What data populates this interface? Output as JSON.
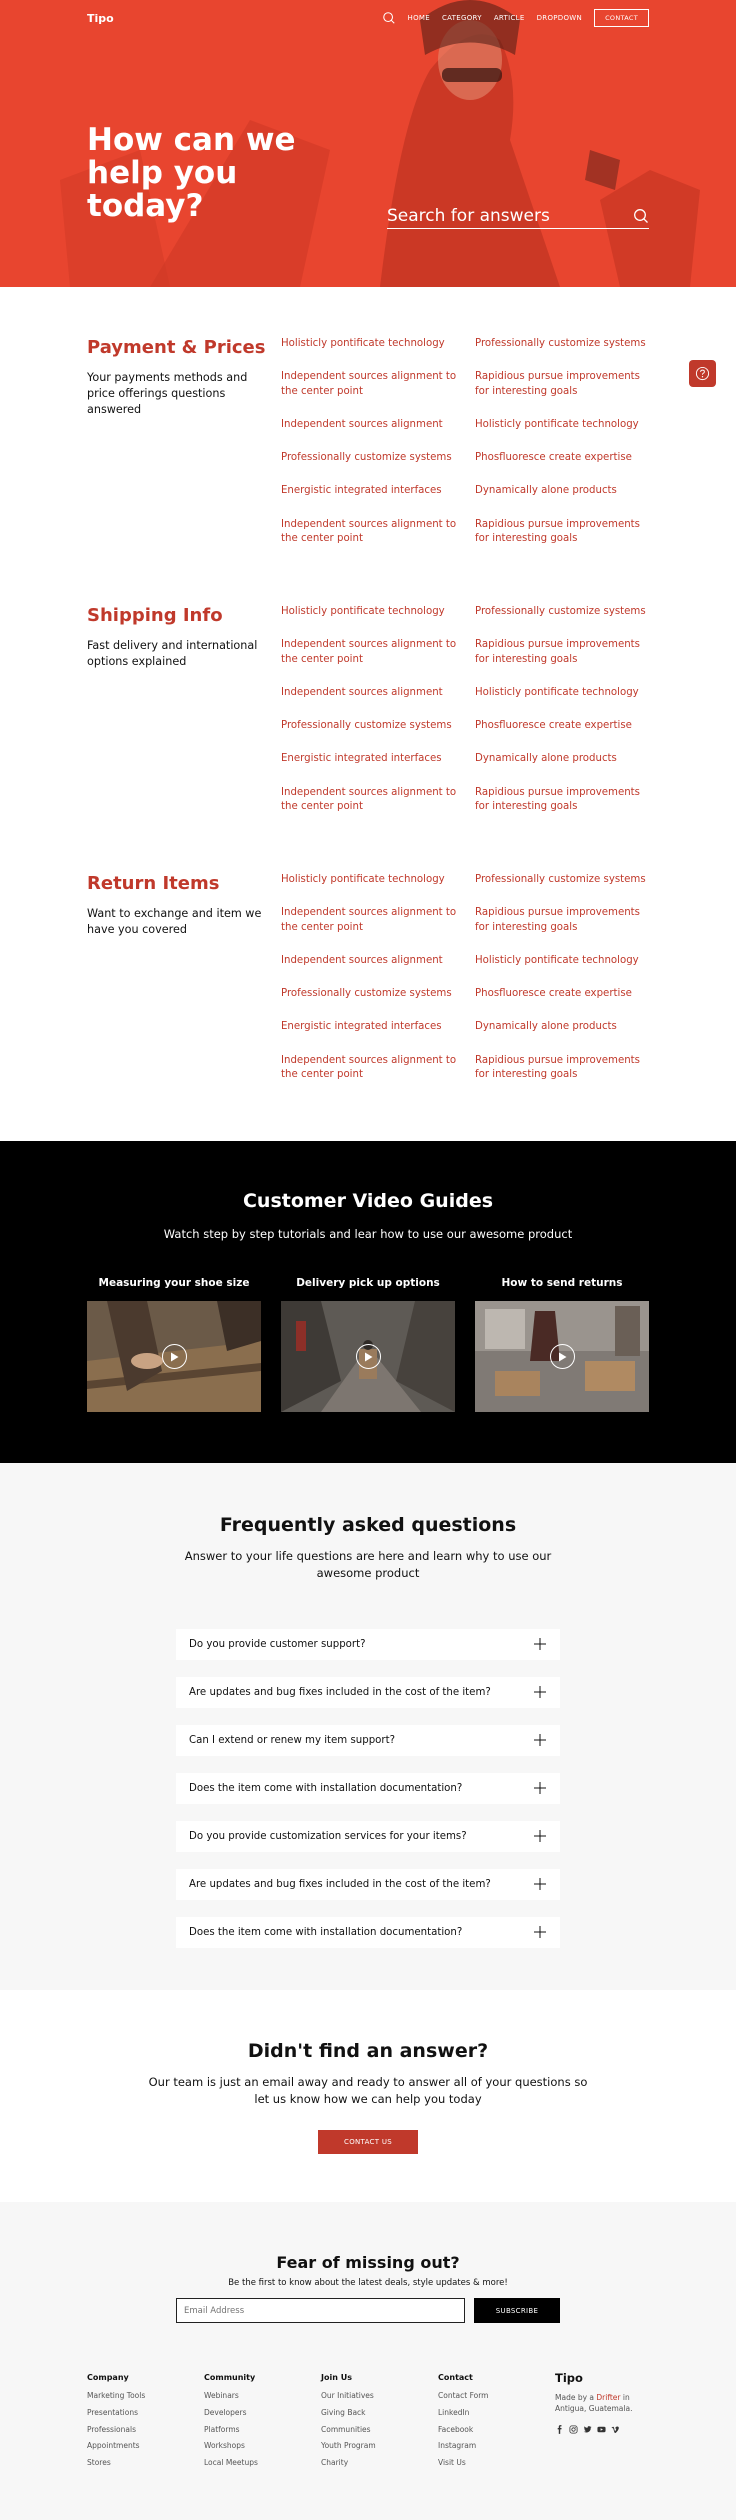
{
  "nav": {
    "logo": "Tipo",
    "links": [
      "HOME",
      "CATEGORY",
      "ARTICLE",
      "DROPDOWN"
    ],
    "contact_label": "CONTACT"
  },
  "hero": {
    "title": "How can we help you today?",
    "search_placeholder": "Search for answers"
  },
  "help_sections": [
    {
      "title": "Payment & Prices",
      "subtitle": "Your payments methods and price offerings questions answered",
      "links": [
        "Holisticly pontificate technology",
        "Professionally customize systems",
        "Independent sources alignment to the center point",
        "Rapidious pursue improvements for interesting goals",
        "Independent sources alignment",
        "Holisticly pontificate technology",
        "Professionally customize systems",
        "Phosfluoresce create expertise",
        "Energistic integrated interfaces",
        "Dynamically alone products",
        "Independent sources alignment to the center point",
        "Rapidious pursue improvements for interesting goals"
      ]
    },
    {
      "title": "Shipping Info",
      "subtitle": "Fast delivery and international options explained",
      "links": [
        "Holisticly pontificate technology",
        "Professionally customize systems",
        "Independent sources alignment to the center point",
        "Rapidious pursue improvements for interesting goals",
        "Independent sources alignment",
        "Holisticly pontificate technology",
        "Professionally customize systems",
        "Phosfluoresce create expertise",
        "Energistic integrated interfaces",
        "Dynamically alone products",
        "Independent sources alignment to the center point",
        "Rapidious pursue improvements for interesting goals"
      ]
    },
    {
      "title": "Return Items",
      "subtitle": "Want to exchange and item we have you covered",
      "links": [
        "Holisticly pontificate technology",
        "Professionally customize systems",
        "Independent sources alignment to the center point",
        "Rapidious pursue improvements for interesting goals",
        "Independent sources alignment",
        "Holisticly pontificate technology",
        "Professionally customize systems",
        "Phosfluoresce create expertise",
        "Energistic integrated interfaces",
        "Dynamically alone products",
        "Independent sources alignment to the center point",
        "Rapidious pursue improvements for interesting goals"
      ]
    }
  ],
  "videos": {
    "title": "Customer Video Guides",
    "subtitle": "Watch step by step tutorials and lear how to use our awesome product",
    "items": [
      {
        "label": "Measuring your shoe size"
      },
      {
        "label": "Delivery pick up options"
      },
      {
        "label": "How to send returns"
      }
    ]
  },
  "faq": {
    "title": "Frequently asked questions",
    "subtitle": "Answer to your life questions are here and learn why to use our awesome product",
    "questions": [
      "Do you provide customer support?",
      "Are updates and bug fixes included in the cost of the item?",
      "Can I extend or renew my item support?",
      "Does the item come with installation documentation?",
      "Do you provide customization services for your items?",
      "Are updates and bug fixes included in the cost of the item?",
      "Does the item come with installation documentation?"
    ]
  },
  "no_answer": {
    "title": "Didn't find an answer?",
    "subtitle": "Our team is just an email away and ready to answer all of your questions so let us know how we can help you today",
    "button": "CONTACT US"
  },
  "newsletter": {
    "title": "Fear of missing out?",
    "subtitle": "Be the first to know about the latest deals, style updates & more!",
    "placeholder": "Email Address",
    "button": "SUBSCRIBE"
  },
  "footer": {
    "columns": [
      {
        "title": "Company",
        "links": [
          "Marketing Tools",
          "Presentations",
          "Professionals",
          "Appointments",
          "Stores"
        ]
      },
      {
        "title": "Community",
        "links": [
          "Webinars",
          "Developers",
          "Platforms",
          "Workshops",
          "Local Meetups"
        ]
      },
      {
        "title": "Join Us",
        "links": [
          "Our Initiatives",
          "Giving Back",
          "Communities",
          "Youth Program",
          "Charity"
        ]
      },
      {
        "title": "Contact",
        "links": [
          "Contact Form",
          "LinkedIn",
          "Facebook",
          "Instagram",
          "Visit Us"
        ]
      }
    ],
    "brand": "Tipo",
    "made_by_prefix": "Made by a",
    "made_by_name": "Drifter",
    "made_by_suffix": "in Antigua, Guatemala.",
    "social_icons": [
      "facebook-icon",
      "instagram-icon",
      "twitter-icon",
      "youtube-icon",
      "vimeo-icon"
    ]
  },
  "colors": {
    "hero_bg": "#e8452f",
    "accent": "#c0392b",
    "dark": "#000000",
    "light_bg": "#f7f7f7"
  }
}
